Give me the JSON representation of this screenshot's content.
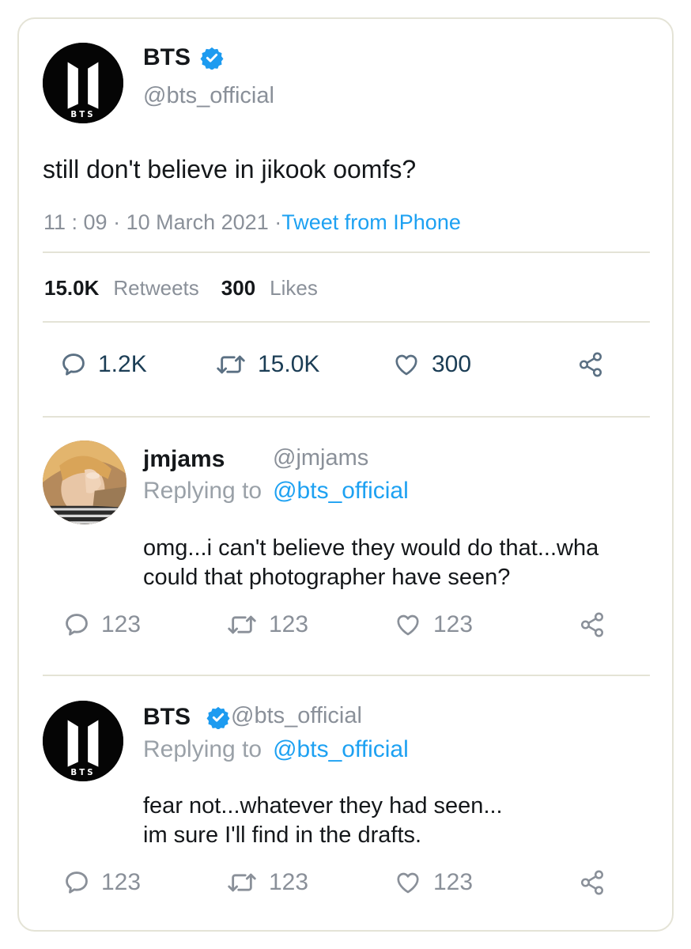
{
  "main_tweet": {
    "name": "BTS",
    "handle": "@bts_official",
    "logo_text": "BTS",
    "text": "still don't believe in jikook oomfs?",
    "time": "11 : 09",
    "date": "10 March 2021",
    "source": "Tweet from IPhone",
    "retweets_count": "15.0K",
    "retweets_label": "Retweets",
    "likes_count": "300",
    "likes_label": "Likes",
    "actions": {
      "replies": "1.2K",
      "retweets": "15.0K",
      "likes": "300"
    }
  },
  "reply_1": {
    "name": "jmjams",
    "handle": "@jmjams",
    "replying_label": "Replying to",
    "replying_to": "@bts_official",
    "line1": "omg...i can't believe they would do that...wha",
    "line2": "could that photographer have seen?",
    "actions": {
      "replies": "123",
      "retweets": "123",
      "likes": "123"
    }
  },
  "reply_2": {
    "name": "BTS",
    "handle": "@bts_official",
    "logo_text": "BTS",
    "replying_label": "Replying to",
    "replying_to": "@bts_official",
    "line1": "fear not...whatever they had seen...",
    "line2": "im sure I'll find in the drafts.",
    "actions": {
      "replies": "123",
      "retweets": "123",
      "likes": "123"
    }
  },
  "colors": {
    "accent_blue": "#1da1f2",
    "verified_blue": "#1d9bf0",
    "muted_text": "#8a9099",
    "divider": "#e4e3d6",
    "action_count_main": "#1b3d55"
  },
  "icons": [
    "verified-badge-icon",
    "reply-icon",
    "retweet-icon",
    "like-icon",
    "share-icon"
  ]
}
